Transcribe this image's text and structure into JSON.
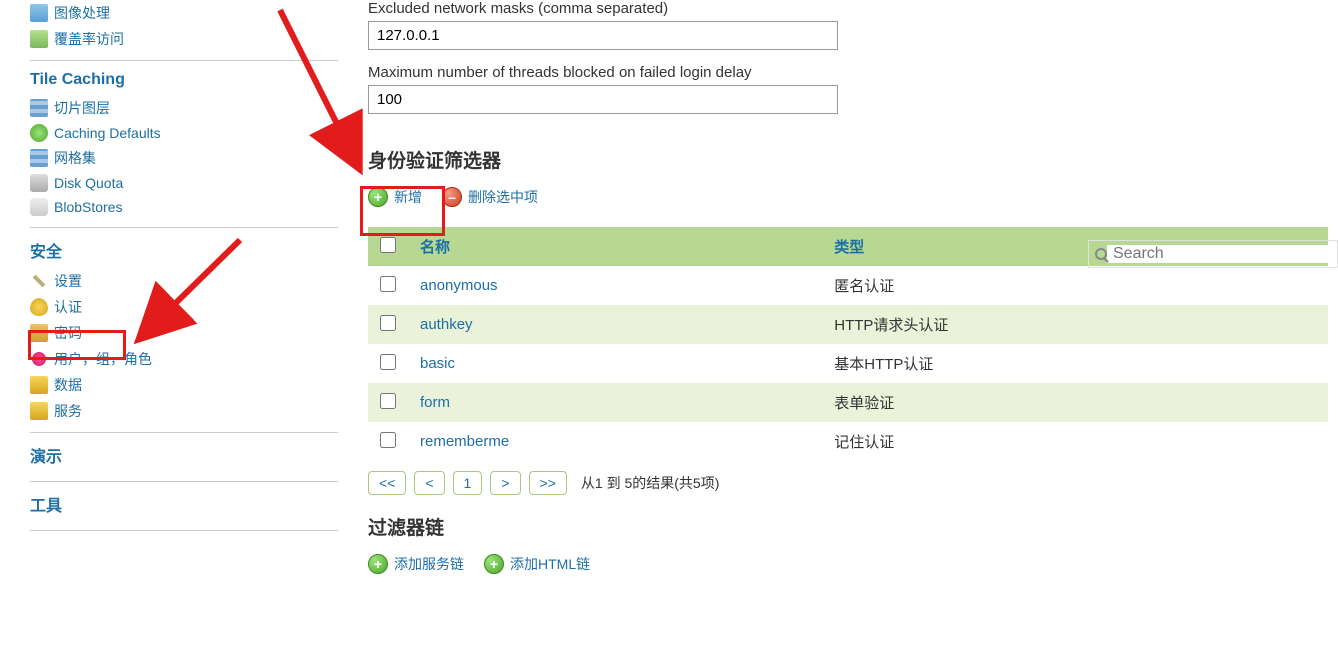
{
  "sidebar": {
    "wms_items": [
      {
        "label": "图像处理",
        "icon": "image-processing-icon"
      },
      {
        "label": "覆盖率访问",
        "icon": "coverage-access-icon"
      }
    ],
    "tile_caching": {
      "title": "Tile Caching",
      "items": [
        {
          "label": "切片图层",
          "icon": "tile-layers-icon"
        },
        {
          "label": "Caching Defaults",
          "icon": "caching-defaults-icon"
        },
        {
          "label": "网格集",
          "icon": "gridsets-icon"
        },
        {
          "label": "Disk Quota",
          "icon": "disk-quota-icon"
        },
        {
          "label": "BlobStores",
          "icon": "blobstores-icon"
        }
      ]
    },
    "security": {
      "title": "安全",
      "items": [
        {
          "label": "设置",
          "icon": "settings-icon"
        },
        {
          "label": "认证",
          "icon": "authentication-icon"
        },
        {
          "label": "密码",
          "icon": "password-icon"
        },
        {
          "label": "用户，组，角色",
          "icon": "users-groups-roles-icon"
        },
        {
          "label": "数据",
          "icon": "data-icon"
        },
        {
          "label": "服务",
          "icon": "services-icon"
        }
      ]
    },
    "demo": {
      "title": "演示"
    },
    "tools": {
      "title": "工具"
    }
  },
  "main": {
    "excluded_masks": {
      "label": "Excluded network masks (comma separated)",
      "value": "127.0.0.1"
    },
    "max_threads": {
      "label": "Maximum number of threads blocked on failed login delay",
      "value": "100"
    },
    "auth_filters_heading": "身份验证筛选器",
    "add_label": "新增",
    "remove_label": "删除选中项",
    "search_placeholder": "Search",
    "table": {
      "col_name": "名称",
      "col_type": "类型",
      "rows": [
        {
          "name": "anonymous",
          "type": "匿名认证"
        },
        {
          "name": "authkey",
          "type": "HTTP请求头认证"
        },
        {
          "name": "basic",
          "type": "基本HTTP认证"
        },
        {
          "name": "form",
          "type": "表单验证"
        },
        {
          "name": "rememberme",
          "type": "记住认证"
        }
      ]
    },
    "pager": {
      "first": "<<",
      "prev": "<",
      "page": "1",
      "next": ">",
      "last": ">>",
      "summary": "从1 到 5的结果(共5项)"
    },
    "filter_chains_heading": "过滤器链",
    "add_service_chain": "添加服务链",
    "add_html_chain": "添加HTML链"
  }
}
